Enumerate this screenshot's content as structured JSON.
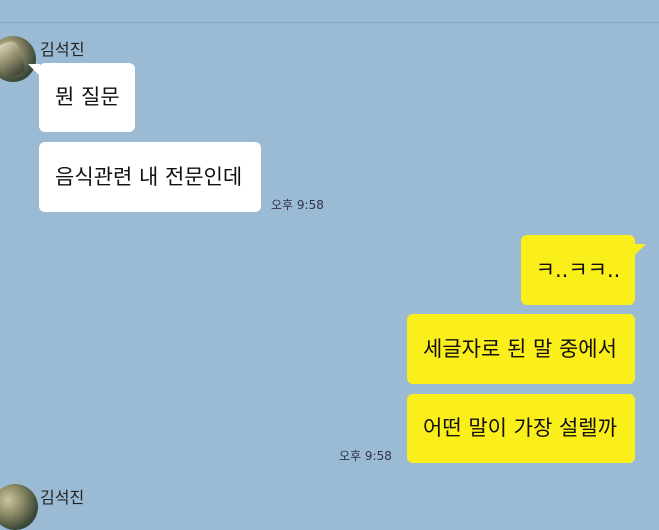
{
  "chat": {
    "messages_group_1": {
      "sender": "김석진",
      "bubbles": [
        "뭔 질문",
        "음식관련 내 전문인데"
      ],
      "time": "오후 9:58"
    },
    "messages_group_2": {
      "bubbles": [
        "ㅋ..ㅋㅋ..",
        "세글자로 된 말 중에서",
        "어떤 말이 가장 설렐까"
      ],
      "time": "오후 9:58"
    },
    "next_sender": "김석진"
  },
  "colors": {
    "background": "#9bbbd4",
    "incoming_bubble": "#ffffff",
    "outgoing_bubble": "#fbef1b"
  }
}
